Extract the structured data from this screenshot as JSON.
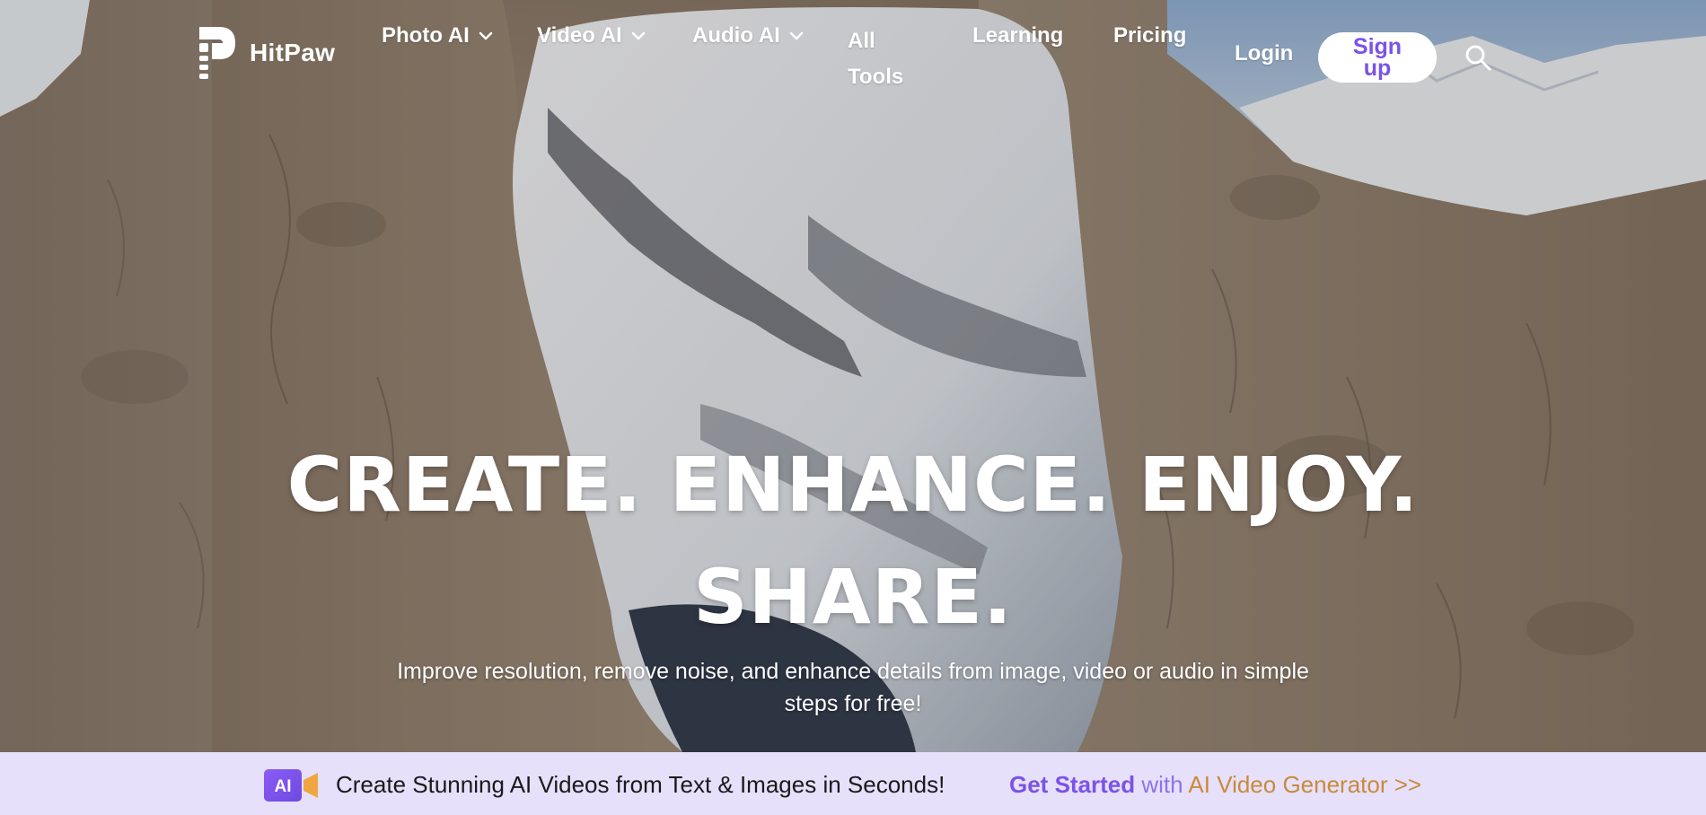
{
  "brand": {
    "name": "HitPaw"
  },
  "nav": {
    "items": [
      {
        "label": "Photo AI",
        "has_dropdown": true
      },
      {
        "label": "Video AI",
        "has_dropdown": true
      },
      {
        "label": "Audio AI",
        "has_dropdown": true
      }
    ],
    "all_tools_line1": "All",
    "all_tools_line2": "Tools",
    "learning": "Learning",
    "pricing": "Pricing",
    "login": "Login",
    "signup_line1": "Sign",
    "signup_line2": "up",
    "search_icon": "search-icon"
  },
  "hero": {
    "headline_line1": "CREATE. ENHANCE. ENJOY.",
    "headline_line2": "SHARE.",
    "subline_line1": "Improve resolution, remove noise, and enhance details from image, video or audio in simple",
    "subline_line2": "steps for free!"
  },
  "banner": {
    "badge": "AI",
    "text": "Create Stunning AI Videos from Text & Images in Seconds!",
    "link_part1": "Get Started",
    "link_part2": " with ",
    "link_part3": "AI Video Generator >>"
  },
  "colors": {
    "accent": "#7b52e8",
    "banner_bg": "#e6e0fb",
    "link_gold": "#c98a3a"
  }
}
